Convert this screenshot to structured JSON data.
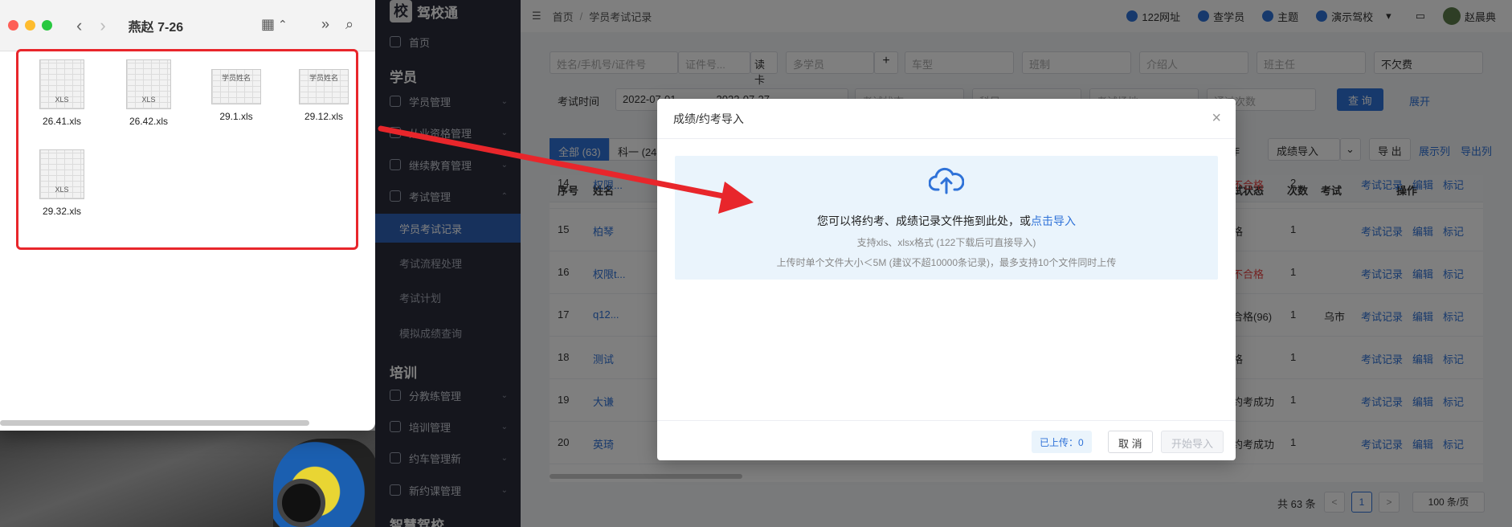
{
  "finder": {
    "title": "燕赵 7-26",
    "nav_back": "‹",
    "nav_forward": "›",
    "files": [
      {
        "name": "26.41.xls",
        "tag": "XLS"
      },
      {
        "name": "26.42.xls",
        "tag": "XLS"
      },
      {
        "name": "29.1.xls",
        "tag": "学员姓名"
      },
      {
        "name": "29.12.xls",
        "tag": "学员姓名"
      },
      {
        "name": "29.32.xls",
        "tag": "XLS"
      }
    ],
    "highlight_color": "#e8262b"
  },
  "sidebar": {
    "logo": "校",
    "brand": "驾校通",
    "home": "首页",
    "group_students": "学员",
    "items": [
      "学员管理",
      "从业资格管理",
      "继续教育管理",
      "考试管理"
    ],
    "sub_items": [
      "学员考试记录",
      "考试流程处理",
      "考试计划",
      "模拟成绩查询"
    ],
    "group_training": "培训",
    "training_items": [
      "分教练管理",
      "培训管理",
      "约车管理新",
      "新约课管理"
    ],
    "group_smart": "智慧驾校"
  },
  "topbar": {
    "breadcrumb_home": "首页",
    "breadcrumb_sep": "/",
    "breadcrumb_current": "学员考试记录",
    "links": [
      "122网址",
      "查学员",
      "主题",
      "演示驾校"
    ],
    "user": "赵晨典"
  },
  "filters": {
    "name_placeholder": "姓名/手机号/证件号",
    "id_placeholder": "证件号...",
    "read_card": "读卡",
    "multi_student": "多学员",
    "car_type": "车型",
    "class": "班制",
    "referrer": "介绍人",
    "head_teacher": "班主任",
    "fee": "不欠费",
    "exam_time_label": "考试时间",
    "date_from": "2022-07-01",
    "date_to": "2022-07-27",
    "exam_status": "考试状态",
    "subject": "科目",
    "exam_venue": "考试场地",
    "pass_count": "通过次数",
    "search": "查 询",
    "expand": "展开"
  },
  "tabs": [
    {
      "label": "全部 (63)",
      "active": true
    },
    {
      "label": "科一 (24",
      "active": false
    }
  ],
  "actions": {
    "operation_hint": "作",
    "import_score": "成绩导入",
    "export": "导 出",
    "show_cols": "展示列",
    "export_cols": "导出列"
  },
  "table": {
    "headers": {
      "no": "序号",
      "name": "姓名",
      "status": "试状态",
      "count": "次数",
      "exam": "考试",
      "ops": "操作"
    },
    "rows": [
      {
        "no": "14",
        "name": "权限...",
        "status": "不合格",
        "count": "2",
        "extra": ""
      },
      {
        "no": "15",
        "name": "柏琴",
        "status": "格",
        "count": "1",
        "extra": ""
      },
      {
        "no": "16",
        "name": "权限t...",
        "status": "不合格",
        "count": "1",
        "extra": ""
      },
      {
        "no": "17",
        "name": "q12...",
        "status": "合格(96)",
        "count": "1",
        "extra": "乌市"
      },
      {
        "no": "18",
        "name": "测试",
        "status": "格",
        "count": "1",
        "extra": ""
      },
      {
        "no": "19",
        "name": "大谦",
        "status": "约考成功",
        "count": "1",
        "extra": ""
      },
      {
        "no": "20",
        "name": "英琦",
        "status": "约考成功",
        "count": "1",
        "extra": ""
      }
    ],
    "op_labels": {
      "record": "考试记录",
      "edit": "编辑",
      "mark": "标记"
    }
  },
  "pager": {
    "total": "共 63 条",
    "prev": "<",
    "page": "1",
    "next": ">",
    "size": "100 条/页"
  },
  "modal": {
    "title": "成绩/约考导入",
    "close": "×",
    "drop_text": "您可以将约考、成绩记录文件拖到此处，或",
    "drop_link": "点击导入",
    "format_hint": "支持xls、xlsx格式 (122下载后可直接导入)",
    "size_hint": "上传时单个文件大小＜5M (建议不超10000条记录)，最多支持10个文件同时上传",
    "uploaded": "已上传：0",
    "cancel": "取 消",
    "start": "开始导入"
  },
  "colors": {
    "accent": "#2f72d8",
    "sidebar_bg": "#2b2d3a",
    "annotation": "#e8262b"
  }
}
